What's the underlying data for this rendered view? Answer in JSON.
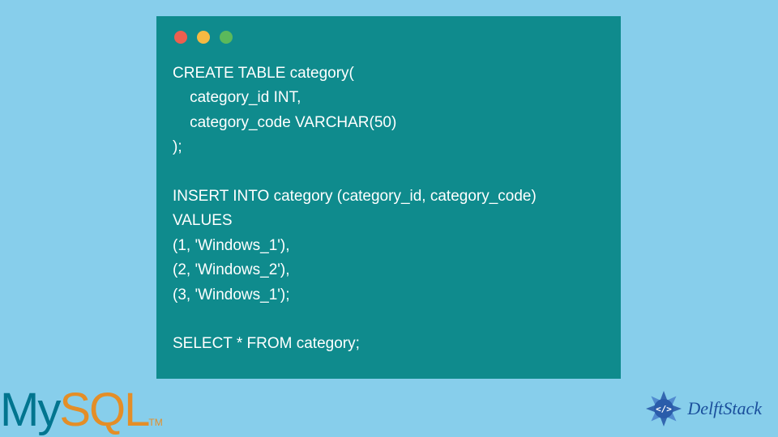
{
  "code": {
    "content": "CREATE TABLE category(\n    category_id INT,\n    category_code VARCHAR(50)\n);\n\nINSERT INTO category (category_id, category_code)\nVALUES\n(1, 'Windows_1'),\n(2, 'Windows_2'),\n(3, 'Windows_1');\n\nSELECT * FROM category;"
  },
  "logos": {
    "mysql_my": "My",
    "mysql_sql": "SQL",
    "mysql_tm": "TM",
    "delft": "DelftStack"
  }
}
